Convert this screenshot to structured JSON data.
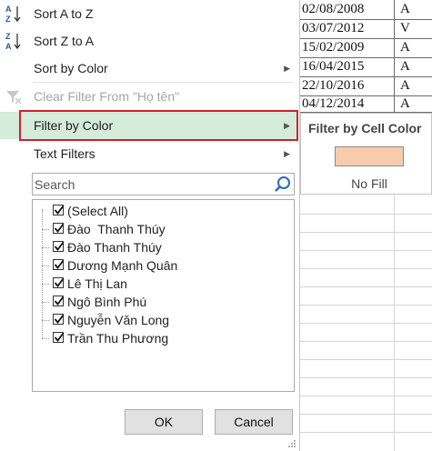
{
  "sheet": {
    "dates": [
      "02/08/2008",
      "03/07/2012",
      "15/02/2009",
      "16/04/2015",
      "22/10/2016",
      "04/12/2014"
    ],
    "col2": [
      "A",
      "V",
      "A",
      "A",
      "A",
      "A"
    ]
  },
  "menu": {
    "sort_az": "Sort A to Z",
    "sort_za": "Sort Z to A",
    "sort_color": "Sort by Color",
    "clear_filter": "Clear Filter From \"Họ tên\"",
    "filter_color": "Filter by Color",
    "text_filters": "Text Filters",
    "sort_az_prefix": "S",
    "sort_az_u": "o",
    "sort_az_rest": "rt A to Z"
  },
  "search": {
    "placeholder": "Search"
  },
  "list": {
    "items": [
      "(Select All)",
      "Đào  Thanh Thúy",
      "Đào Thanh Thúy",
      "Dương Mạnh Quân",
      "Lê Thị Lan",
      "Ngô Bình Phú",
      "Nguyễn Văn Long",
      "Trần Thu Phương"
    ]
  },
  "buttons": {
    "ok": "OK",
    "cancel": "Cancel"
  },
  "submenu": {
    "title": "Filter by Cell Color",
    "no_fill": "No Fill",
    "swatch_color": "#f8cbad"
  },
  "colors": {
    "highlight": "#d4ecd9",
    "outline": "#d0202a"
  }
}
